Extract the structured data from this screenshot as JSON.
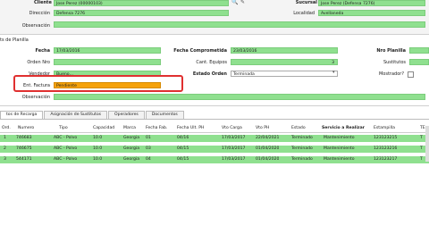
{
  "header": {
    "cliente_label": "Cliente",
    "cliente_value": "Jose Perez (00000103)",
    "sucursal_label": "Sucursal",
    "sucursal_value": "Jose Perez (Defensa 7276)",
    "direccion_label": "Dirección",
    "direccion_value": "Defensa 7276",
    "localidad_label": "Localidad",
    "localidad_value": "Avellaneda",
    "observacion_label": "Observación",
    "observacion_value": ""
  },
  "section_title": "ts de Planilla",
  "form": {
    "fecha_label": "Fecha",
    "fecha_value": "17/03/2016",
    "fecha_comp_label": "Fecha Comprometida",
    "fecha_comp_value": "23/03/2016",
    "nro_planilla_label": "Nro Planilla",
    "nro_planilla_value": "",
    "orden_label": "Orden Nro",
    "orden_value": "",
    "cant_equipos_label": "Cant. Equipos",
    "cant_equipos_value": "3",
    "sustitutos_label": "Sustitutos",
    "sustitutos_value": "",
    "vendedor_label": "Vendedor",
    "vendedor_value": "Bueno...",
    "estado_label": "Estado Orden",
    "estado_value": "Terminada",
    "mostrador_label": "Mostrador?",
    "ent_factura_label": "Ent. Factura",
    "ent_factura_value": "Pendiente",
    "observacion_label": "Observación",
    "observacion_value": ""
  },
  "tabs": [
    {
      "label": "tos de Recarga"
    },
    {
      "label": "Asignación de Sustitutos"
    },
    {
      "label": "Operadores"
    },
    {
      "label": "Documentos"
    }
  ],
  "table": {
    "columns": [
      "Ord.",
      "Numero",
      "Tipo",
      "Capacidad",
      "Marca",
      "Fecha Fab.",
      "Fecha Ult. PH",
      "Vto Carga",
      "Vto PH",
      "Estado",
      "Servicio a Realizar",
      "Estampilla",
      "TE"
    ],
    "rows": [
      [
        "1",
        "746683",
        "ABC - Polvo",
        "10.0",
        "Georgia",
        "01",
        "04/16",
        "17/03/2017",
        "22/04/2021",
        "Terminado",
        "Mantenimiento",
        "123123215",
        "T"
      ],
      [
        "2",
        "746675",
        "ABC - Polvo",
        "10.0",
        "Georgia",
        "03",
        "04/15",
        "17/03/2017",
        "01/04/2020",
        "Terminado",
        "Mantenimiento",
        "123123216",
        "T"
      ],
      [
        "3",
        "544171",
        "ABC - Polvo",
        "10.0",
        "Georgia",
        "04",
        "04/15",
        "17/03/2017",
        "01/04/2020",
        "Terminado",
        "Mantenimiento",
        "123123217",
        "T"
      ]
    ]
  },
  "colors": {
    "field_green": "#8fe08f",
    "row_green": "#8fe08f",
    "highlight_orange": "#f5a20a",
    "annotation_red": "#e03030"
  }
}
